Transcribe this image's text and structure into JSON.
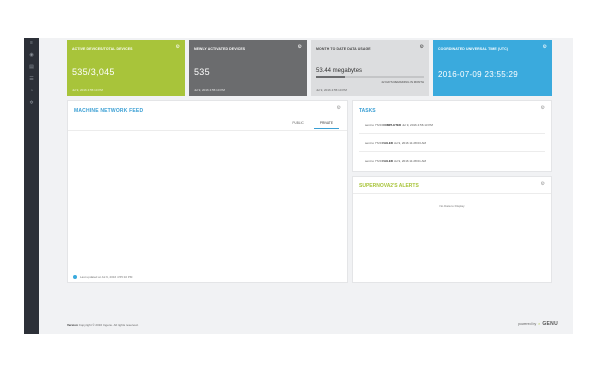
{
  "sidebar": {
    "icons": [
      "menu-icon",
      "globe-icon",
      "chart-icon",
      "list-icon",
      "bell-icon",
      "settings-icon"
    ]
  },
  "tiles": {
    "active_devices": {
      "title": "ACTIVE DEVICES/TOTAL DEVICES",
      "value": "535/3,045",
      "sub": "Jul 9, 2016 4:55:10 PM"
    },
    "newly_activated": {
      "title": "NEWLY ACTIVATED DEVICES",
      "value": "535",
      "sub": "Jul 9, 2016 4:55:10 PM"
    },
    "data_usage": {
      "title": "MONTH TO DATE DATA USAGE",
      "value": "53.44 megabytes",
      "remaining": "22 DAYS REMAINING IN MONTH",
      "sub": "Jul 9, 2016 4:55:10 PM",
      "fill_fraction": 0.27
    },
    "utc": {
      "title": "COORDINATED UNIVERSAL TIME (UTC)",
      "value": "2016-07-09 23:55:29"
    }
  },
  "feed": {
    "title": "MACHINE NETWORK FEED",
    "tabs": [
      "PUBLIC",
      "PRIVATE"
    ],
    "active_tab": "PRIVATE",
    "last_updated": "Last updated at Jul 9, 2016 4:55:10 PM"
  },
  "tasks": {
    "title": "TASKS",
    "rows": [
      {
        "prefix": "sent to 7720",
        "status": "COMPLETED",
        "time": "Jul 9, 2016 4:56:13 PM"
      },
      {
        "prefix": "sent to 7720",
        "status": "FAILED",
        "time": "Jul 9, 2016 11:28:03 AM"
      },
      {
        "prefix": "sent to 7720",
        "status": "FAILED",
        "time": "Jul 9, 2016 11:28:01 AM"
      }
    ]
  },
  "alerts": {
    "title": "SUPERNOVA2'S ALERTS",
    "empty_text": "No Data to Display"
  },
  "footer": {
    "version_label": "Version",
    "copyright": "Copyright © 2016 Ingenu. All rights reserved.",
    "powered_by": "powered by",
    "brand": "GENU"
  },
  "colors": {
    "green": "#a8c43a",
    "gray": "#6b6c6e",
    "light_gray": "#dcdddf",
    "blue": "#3aaadd",
    "sidebar": "#2c3038"
  }
}
